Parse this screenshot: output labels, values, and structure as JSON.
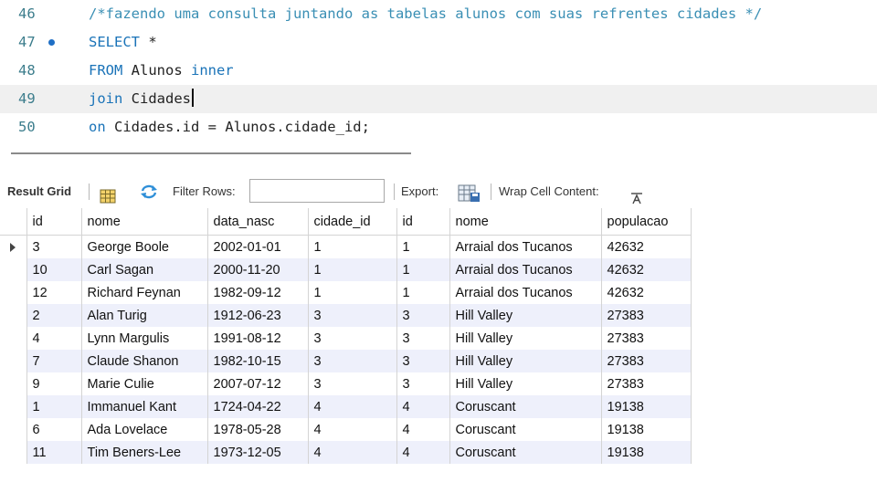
{
  "editor": {
    "lines": [
      {
        "number": "46",
        "segments": [
          {
            "cls": "cmt",
            "text": "/*fazendo uma consulta juntando as tabelas alunos com suas refrentes cidades */"
          }
        ]
      },
      {
        "number": "47",
        "breakpoint": true,
        "segments": [
          {
            "cls": "kw",
            "text": "SELECT"
          },
          {
            "cls": "",
            "text": " *"
          }
        ]
      },
      {
        "number": "48",
        "segments": [
          {
            "cls": "kw",
            "text": "FROM"
          },
          {
            "cls": "",
            "text": " Alunos "
          },
          {
            "cls": "kw",
            "text": "inner"
          }
        ]
      },
      {
        "number": "49",
        "active": true,
        "caret": true,
        "segments": [
          {
            "cls": "kw",
            "text": "join"
          },
          {
            "cls": "",
            "text": " Cidades"
          }
        ]
      },
      {
        "number": "50",
        "segments": [
          {
            "cls": "kw",
            "text": "on"
          },
          {
            "cls": "",
            "text": " Cidades.id = Alunos.cidade_id;"
          }
        ]
      }
    ]
  },
  "toolbar": {
    "result_grid_label": "Result Grid",
    "filter_label": "Filter Rows:",
    "filter_value": "",
    "export_label": "Export:",
    "wrap_label": "Wrap Cell Content:",
    "wrap_icon_glyph": "Ī̲A"
  },
  "table": {
    "columns": [
      "id",
      "nome",
      "data_nasc",
      "cidade_id",
      "id",
      "nome",
      "populacao"
    ],
    "rows": [
      [
        "3",
        "George Boole",
        "2002-01-01",
        "1",
        "1",
        "Arraial dos Tucanos",
        "42632"
      ],
      [
        "10",
        "Carl Sagan",
        "2000-11-20",
        "1",
        "1",
        "Arraial dos Tucanos",
        "42632"
      ],
      [
        "12",
        "Richard Feynan",
        "1982-09-12",
        "1",
        "1",
        "Arraial dos Tucanos",
        "42632"
      ],
      [
        "2",
        "Alan Turig",
        "1912-06-23",
        "3",
        "3",
        "Hill Valley",
        "27383"
      ],
      [
        "4",
        "Lynn Margulis",
        "1991-08-12",
        "3",
        "3",
        "Hill Valley",
        "27383"
      ],
      [
        "7",
        "Claude Shanon",
        "1982-10-15",
        "3",
        "3",
        "Hill Valley",
        "27383"
      ],
      [
        "9",
        "Marie Culie",
        "2007-07-12",
        "3",
        "3",
        "Hill Valley",
        "27383"
      ],
      [
        "1",
        "Immanuel Kant",
        "1724-04-22",
        "4",
        "4",
        "Coruscant",
        "19138"
      ],
      [
        "6",
        "Ada Lovelace",
        "1978-05-28",
        "4",
        "4",
        "Coruscant",
        "19138"
      ],
      [
        "11",
        "Tim Beners-Lee",
        "1973-12-05",
        "4",
        "4",
        "Coruscant",
        "19138"
      ]
    ],
    "selected_row": 0
  },
  "colors": {
    "comment": "#3a8fb4",
    "keyword": "#1a73b8",
    "line_number": "#3c7d8c",
    "alt_row": "#eef0fb",
    "active_line": "#f0f0f0"
  }
}
